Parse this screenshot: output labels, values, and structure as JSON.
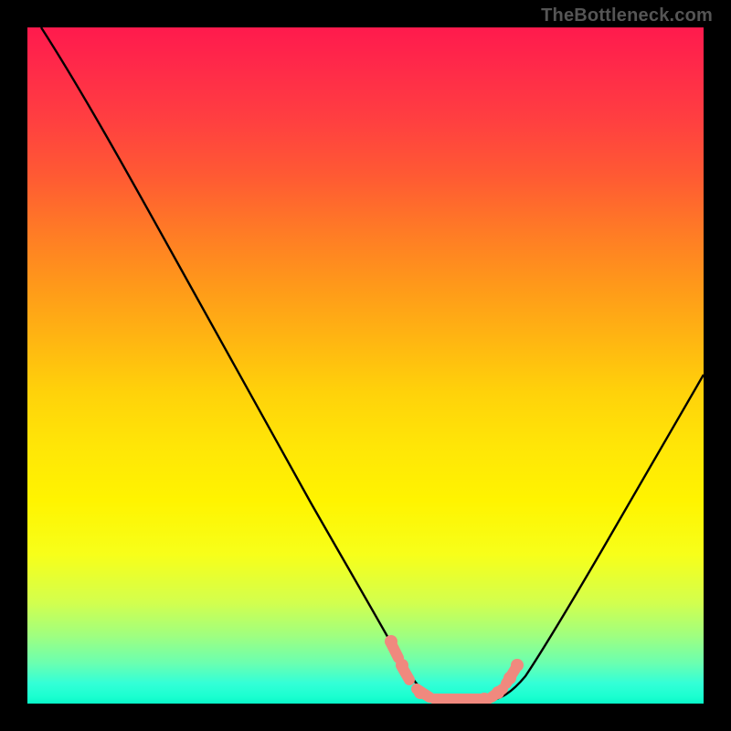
{
  "watermark": "TheBottleneck.com",
  "chart_data": {
    "type": "line",
    "title": "",
    "xlabel": "",
    "ylabel": "",
    "xlim": [
      0,
      100
    ],
    "ylim": [
      0,
      100
    ],
    "grid": false,
    "legend": false,
    "series": [
      {
        "name": "bottleneck-curve",
        "color": "#000000",
        "x": [
          2,
          10,
          18,
          26,
          34,
          42,
          49,
          53,
          57,
          60,
          62,
          65,
          68,
          71,
          75,
          80,
          86,
          92,
          100
        ],
        "y": [
          100,
          87,
          74,
          61,
          48,
          35,
          22,
          14,
          7,
          3,
          1,
          1,
          1,
          2,
          6,
          13,
          25,
          37,
          53
        ]
      },
      {
        "name": "highlight-low",
        "color": "#f0897e",
        "style": "markers",
        "x": [
          54,
          56,
          59,
          61,
          63,
          65,
          67,
          69,
          70,
          71
        ],
        "y": [
          12,
          8,
          3,
          1,
          1,
          1,
          1,
          1,
          2,
          4
        ]
      }
    ],
    "gradient": {
      "orientation": "vertical",
      "stops": [
        {
          "pos": 0.0,
          "color": "#ff1a4d"
        },
        {
          "pos": 0.3,
          "color": "#ff7a26"
        },
        {
          "pos": 0.55,
          "color": "#ffd20a"
        },
        {
          "pos": 0.78,
          "color": "#f7ff1a"
        },
        {
          "pos": 0.92,
          "color": "#8fff90"
        },
        {
          "pos": 1.0,
          "color": "#08f7c8"
        }
      ]
    }
  }
}
